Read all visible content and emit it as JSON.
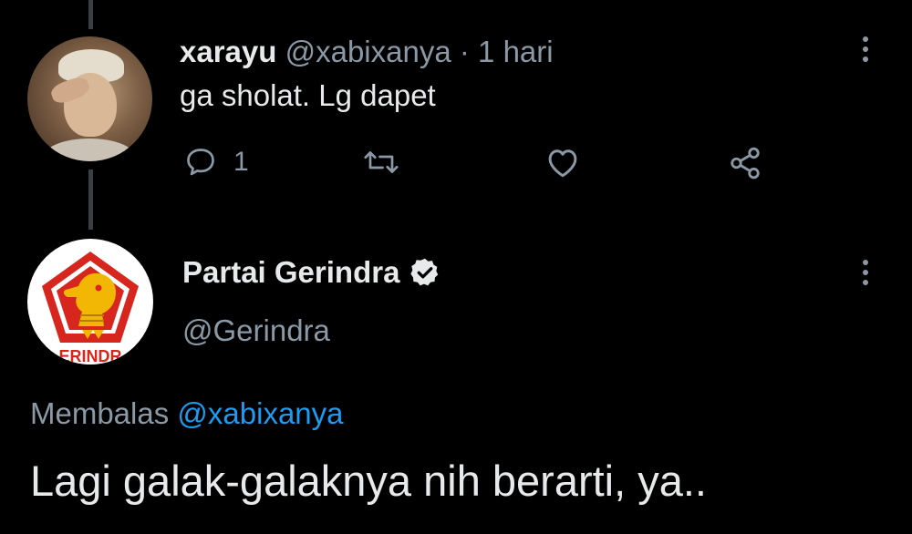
{
  "tweet1": {
    "name": "xarayu",
    "handle": "@xabixanya",
    "separator": "·",
    "time": "1 hari",
    "text": "ga sholat. Lg dapet",
    "reply_count": "1"
  },
  "tweet2": {
    "name": "Partai Gerindra",
    "handle": "@Gerindra",
    "logo_text": "ERINDR",
    "replying_label": "Membalas",
    "replying_to": "@xabixanya",
    "text": "Lagi galak-galaknya nih berarti, ya.."
  },
  "colors": {
    "background": "#000000",
    "text": "#e7e9ea",
    "muted": "#8b98a5",
    "link": "#1d9bf0",
    "logo_red": "#d7261e",
    "logo_gold": "#f2b705"
  },
  "icons": [
    "reply-icon",
    "retweet-icon",
    "like-icon",
    "share-icon",
    "more-icon",
    "verified-icon"
  ]
}
